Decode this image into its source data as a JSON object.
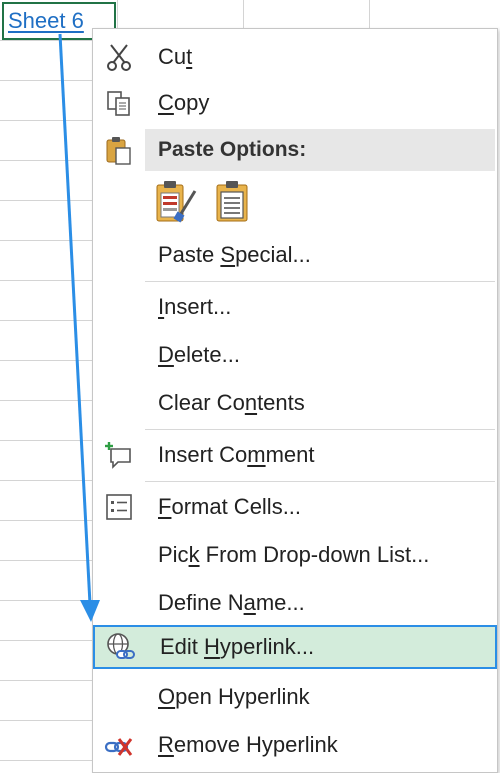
{
  "cell": {
    "text": "Sheet 6"
  },
  "colors": {
    "link": "#1f6fc4",
    "highlight_bg": "#d3ecdb",
    "highlight_border": "#2b8ee6",
    "arrow": "#2b8ee6"
  },
  "menu": {
    "cut": {
      "pre": "Cu",
      "u": "t",
      "post": "",
      "icon": "scissors-icon"
    },
    "copy": {
      "pre": "",
      "u": "C",
      "post": "opy",
      "icon": "copy-icon"
    },
    "paste_options": {
      "label": "Paste Options:",
      "icon": "clipboard-paste-icon"
    },
    "paste_formatting_icon": "paste-formatting-icon",
    "paste_values_icon": "paste-values-icon",
    "paste_special": {
      "pre": "Paste ",
      "u": "S",
      "post": "pecial..."
    },
    "insert": {
      "pre": "",
      "u": "I",
      "post": "nsert..."
    },
    "delete": {
      "pre": "",
      "u": "D",
      "post": "elete..."
    },
    "clear_contents": {
      "pre": "Clear Co",
      "u": "n",
      "post": "tents"
    },
    "insert_comment": {
      "pre": "Insert Co",
      "u": "m",
      "post": "ment",
      "icon": "comment-plus-icon"
    },
    "format_cells": {
      "pre": "",
      "u": "F",
      "post": "ormat Cells...",
      "icon": "format-cells-icon"
    },
    "pick_dropdown": {
      "pre": "Pic",
      "u": "k",
      "post": " From Drop-down List..."
    },
    "define_name": {
      "pre": "Define N",
      "u": "a",
      "post": "me..."
    },
    "edit_hyperlink": {
      "pre": "Edit ",
      "u": "H",
      "post": "yperlink...",
      "icon": "globe-link-icon"
    },
    "open_hyperlink": {
      "pre": "",
      "u": "O",
      "post": "pen Hyperlink"
    },
    "remove_hyperlink": {
      "pre": "",
      "u": "R",
      "post": "emove Hyperlink",
      "icon": "remove-link-icon"
    }
  }
}
